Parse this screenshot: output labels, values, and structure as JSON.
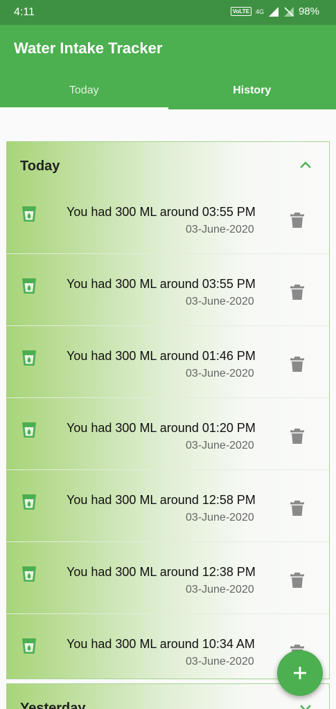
{
  "status_bar": {
    "time": "4:11",
    "network_badge": "VoLTE",
    "network": "4G",
    "battery": "98%"
  },
  "app": {
    "title": "Water Intake Tracker"
  },
  "tabs": [
    {
      "label": "Today",
      "selected": true
    },
    {
      "label": "History",
      "selected": false
    }
  ],
  "sections": {
    "today": {
      "title": "Today",
      "entries": [
        {
          "text": "You had 300 ML around 03:55 PM",
          "date": "03-June-2020"
        },
        {
          "text": "You had 300 ML around 03:55 PM",
          "date": "03-June-2020"
        },
        {
          "text": "You had 300 ML around 01:46 PM",
          "date": "03-June-2020"
        },
        {
          "text": "You had 300 ML around 01:20 PM",
          "date": "03-June-2020"
        },
        {
          "text": "You had 300 ML around 12:58 PM",
          "date": "03-June-2020"
        },
        {
          "text": "You had 300 ML around 12:38 PM",
          "date": "03-June-2020"
        },
        {
          "text": "You had 300 ML around 10:34 AM",
          "date": "03-June-2020"
        }
      ]
    },
    "yesterday": {
      "title": "Yesterday"
    }
  },
  "colors": {
    "primary": "#4caf50",
    "status_bar": "#3e9142",
    "cup_icon": "#4caf50",
    "trash_icon": "#8a8a8a"
  },
  "icons": {
    "entry": "glass-water-icon",
    "delete": "trash-icon",
    "collapse": "chevron-up-icon",
    "expand": "chevron-down-icon",
    "fab": "plus-icon"
  }
}
